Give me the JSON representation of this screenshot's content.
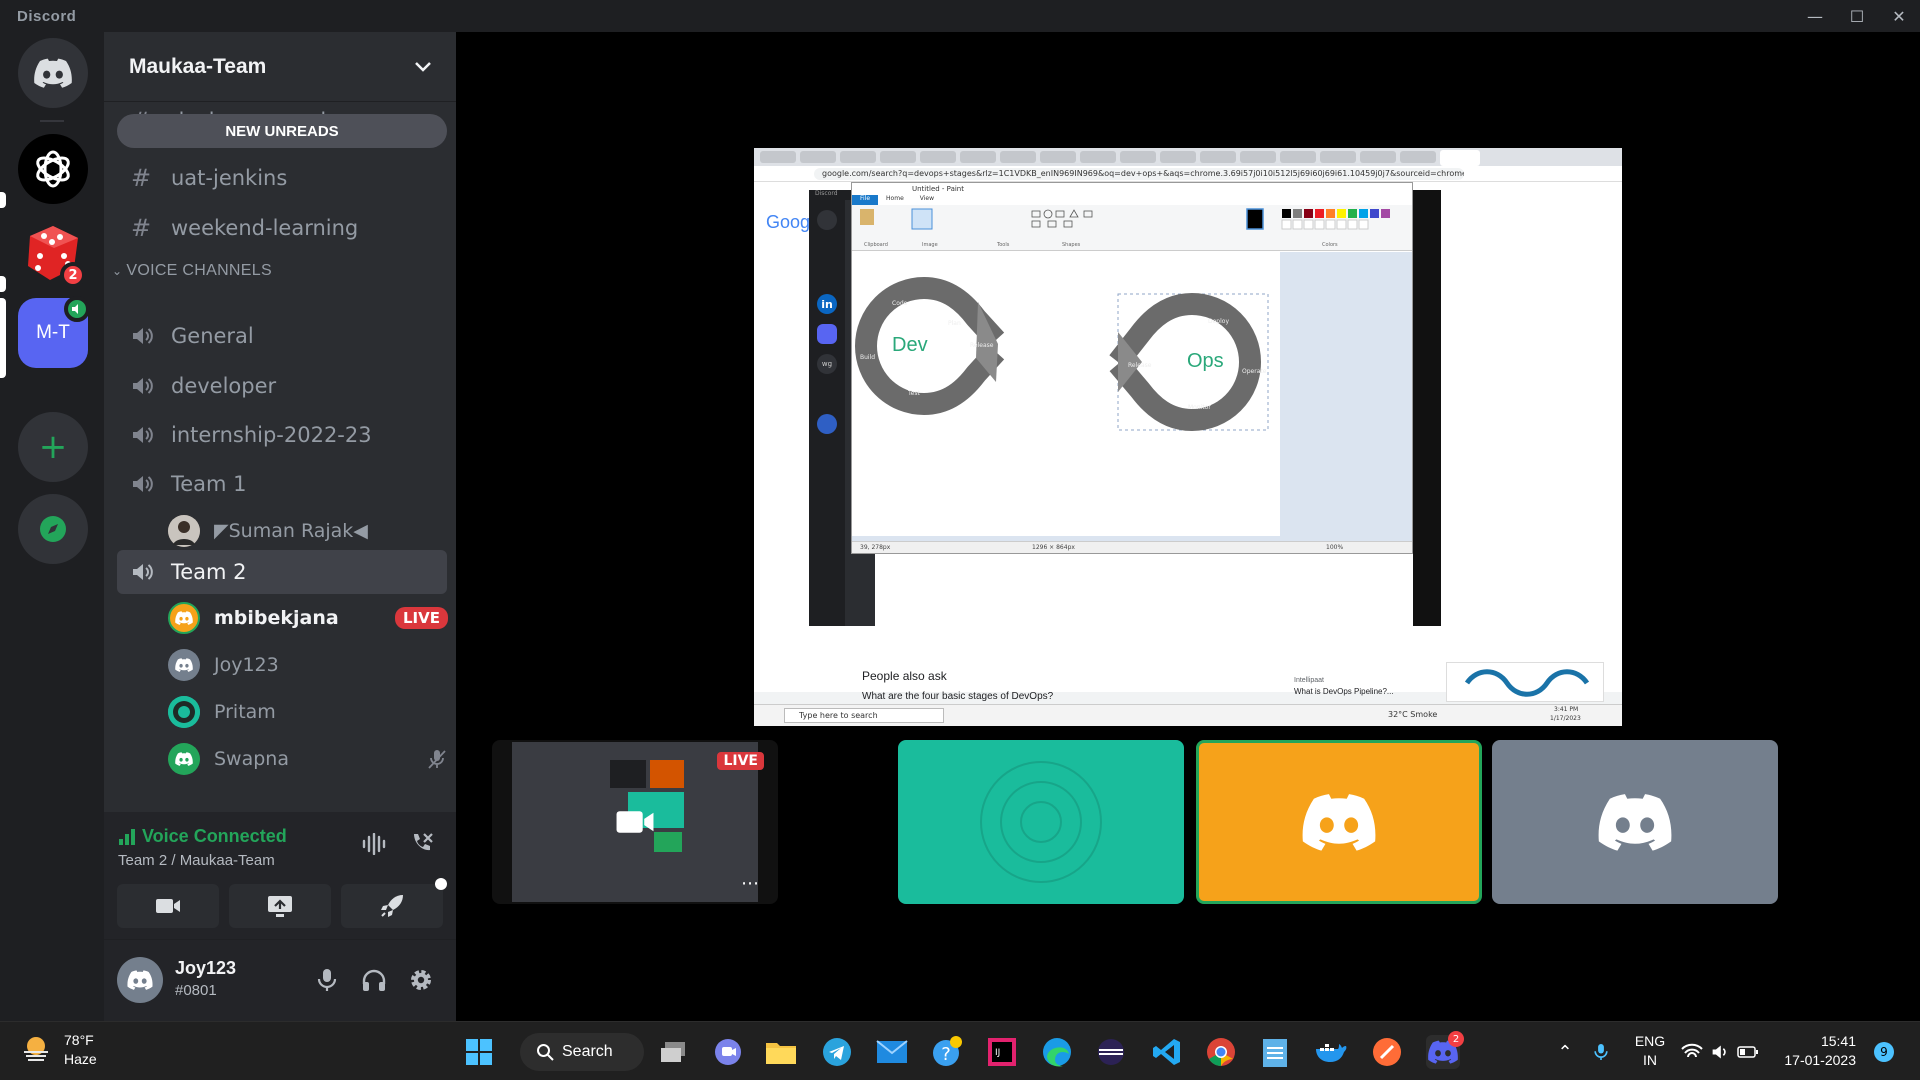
{
  "window": {
    "title": "Discord"
  },
  "guilds": {
    "unread_badge": "2",
    "server_abbrev": "M-T"
  },
  "server": {
    "name": "Maukaa-Team"
  },
  "text_channels": [
    "deckpro-error-log",
    "uat-jenkins",
    "weekend-learning"
  ],
  "new_unreads_label": "NEW UNREADS",
  "voice_category": "VOICE CHANNELS",
  "voice_channels": [
    "General",
    "developer",
    "internship-2022-23",
    "Team 1",
    "Team 2"
  ],
  "team1_users": [
    "◤Suman Rajak◀"
  ],
  "team2_users": [
    {
      "name": "mbibekjana",
      "live": "LIVE"
    },
    {
      "name": "Joy123"
    },
    {
      "name": "Pritam"
    },
    {
      "name": "Swapna"
    }
  ],
  "voice_panel": {
    "status": "Voice Connected",
    "location": "Team 2 / Maukaa-Team"
  },
  "user_panel": {
    "username": "Joy123",
    "discriminator": "#0801"
  },
  "stream": {
    "screen": {
      "url": "google.com/search?q=devops+stages&rlz=1C1VDKB_enIN969IN969&oq=dev+ops+&aqs=chrome.3.69i57j0i10i512l5j69i60j69i61.10459j0j7&sourceid=chrome...",
      "paint_title": "Untitled - Paint",
      "paint_tabs": [
        "File",
        "Home",
        "View"
      ],
      "ribbon_groups": [
        "Clipboard",
        "Image",
        "Tools",
        "Shapes",
        "Colors"
      ],
      "dev_label": "Dev",
      "ops_label": "Ops",
      "dev_stages": [
        "Code",
        "Plan",
        "Build",
        "Test",
        "Release"
      ],
      "ops_stages": [
        "Deploy",
        "Operate",
        "Monitor",
        "Release"
      ],
      "status_coords": "39, 278px",
      "status_size": "1296 × 864px",
      "zoom": "100%",
      "paa_heading": "People also ask",
      "paa_question": "What are the four basic stages of DevOps?",
      "side_result": "What is DevOps Pipeline?...",
      "side_source": "Intellipaat",
      "taskbar_search": "Type here to search",
      "weather": "32°C Smoke",
      "time": "3:41 PM",
      "date": "1/17/2023",
      "mini_guild": "wg"
    }
  },
  "tiles": {
    "live_label": "LIVE"
  },
  "taskbar": {
    "weather_temp": "78°F",
    "weather_cond": "Haze",
    "search_label": "Search",
    "lang": "ENG",
    "region": "IN",
    "time": "15:41",
    "date": "17-01-2023",
    "notif_count": "9",
    "discord_badge": "2"
  },
  "colors": {
    "green": "#23a55a",
    "red": "#f23f43",
    "blurple": "#5865f2",
    "teal_tile": "#1abc9c",
    "orange_tile": "#f6a21a",
    "grey_tile": "#747f8d"
  }
}
